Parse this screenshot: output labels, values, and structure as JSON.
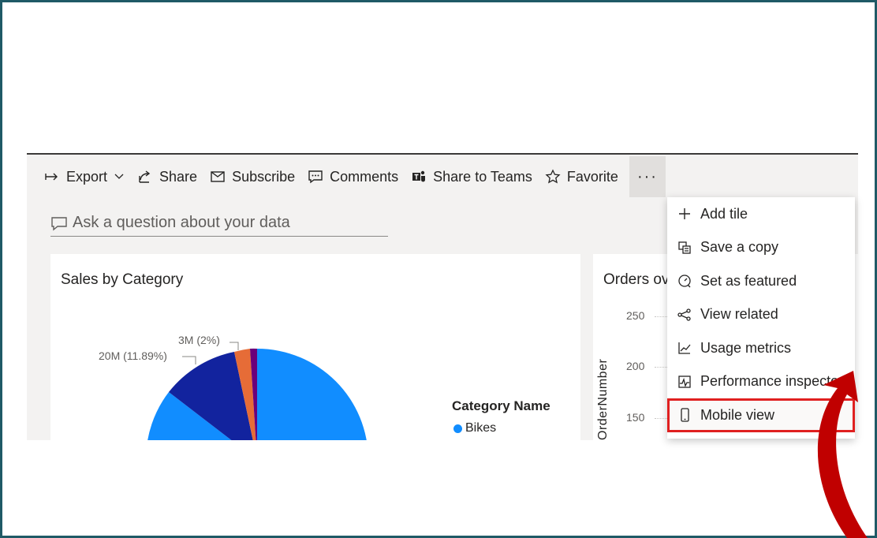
{
  "toolbar": {
    "export_label": "Export",
    "share_label": "Share",
    "subscribe_label": "Subscribe",
    "comments_label": "Comments",
    "share_teams_label": "Share to Teams",
    "favorite_label": "Favorite",
    "more_label": "···"
  },
  "qna": {
    "placeholder": "Ask a question about your data"
  },
  "sales_tile": {
    "title": "Sales by Category",
    "legend_title": "Category Name",
    "legend_items": [
      {
        "label": "Bikes",
        "color": "#118dff"
      }
    ],
    "labels": [
      "3M (2%)",
      "20M (11.89%)"
    ]
  },
  "orders_tile": {
    "title": "Orders ov",
    "y_axis_title": "OrderNumber",
    "y_ticks": [
      "250",
      "200",
      "150"
    ]
  },
  "menu": {
    "items": [
      {
        "label": "Add tile",
        "icon": "plus-icon"
      },
      {
        "label": "Save a copy",
        "icon": "copy-icon"
      },
      {
        "label": "Set as featured",
        "icon": "featured-icon"
      },
      {
        "label": "View related",
        "icon": "related-icon"
      },
      {
        "label": "Usage metrics",
        "icon": "metrics-icon"
      },
      {
        "label": "Performance inspector",
        "icon": "performance-icon"
      },
      {
        "label": "Mobile view",
        "icon": "mobile-icon",
        "highlighted": true
      }
    ]
  },
  "colors": {
    "accent_blue": "#118dff",
    "navy": "#12239e",
    "orange": "#e66c37",
    "purple": "#6b007b",
    "highlight_red": "#e02020",
    "arrow_red": "#c00000"
  }
}
